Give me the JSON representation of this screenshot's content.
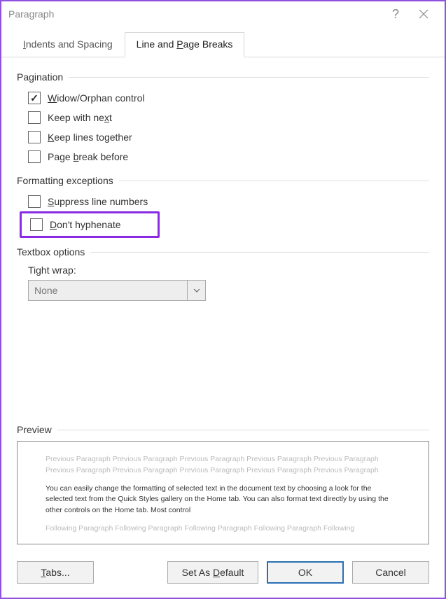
{
  "title": "Paragraph",
  "tabs": {
    "indents": "Indents and Spacing",
    "lineBreaks": "Line and Page Breaks"
  },
  "groups": {
    "pagination": "Pagination",
    "formatting": "Formatting exceptions",
    "textbox": "Textbox options",
    "preview": "Preview"
  },
  "checks": {
    "widow": "idow/Orphan control",
    "widow_u": "W",
    "keepNext": "Keep with ne",
    "keepNext_u": "x",
    "keepNext_after": "t",
    "keepLines": "eep lines together",
    "keepLines_u": "K",
    "pageBreak_pre": "Page ",
    "pageBreak_u": "b",
    "pageBreak_after": "reak before",
    "suppress": "uppress line numbers",
    "suppress_u": "S",
    "hyphen": "on't hyphenate",
    "hyphen_u": "D"
  },
  "tightWrap": {
    "label": "Tight wrap:",
    "value": "None"
  },
  "preview": {
    "faded": "Previous Paragraph Previous Paragraph Previous Paragraph Previous Paragraph Previous Paragraph Previous Paragraph Previous Paragraph Previous Paragraph Previous Paragraph Previous Paragraph",
    "main": "You can easily change the formatting of selected text in the document text by choosing a look for the selected text from the Quick Styles gallery on the Home tab. You can also format text directly by using the other controls on the Home tab. Most control",
    "following": "Following Paragraph Following Paragraph Following Paragraph Following Paragraph Following"
  },
  "buttons": {
    "tabs_u": "T",
    "tabs": "abs...",
    "setDefault_pre": "Set As ",
    "setDefault_u": "D",
    "setDefault_after": "efault",
    "ok": "OK",
    "cancel": "Cancel"
  }
}
